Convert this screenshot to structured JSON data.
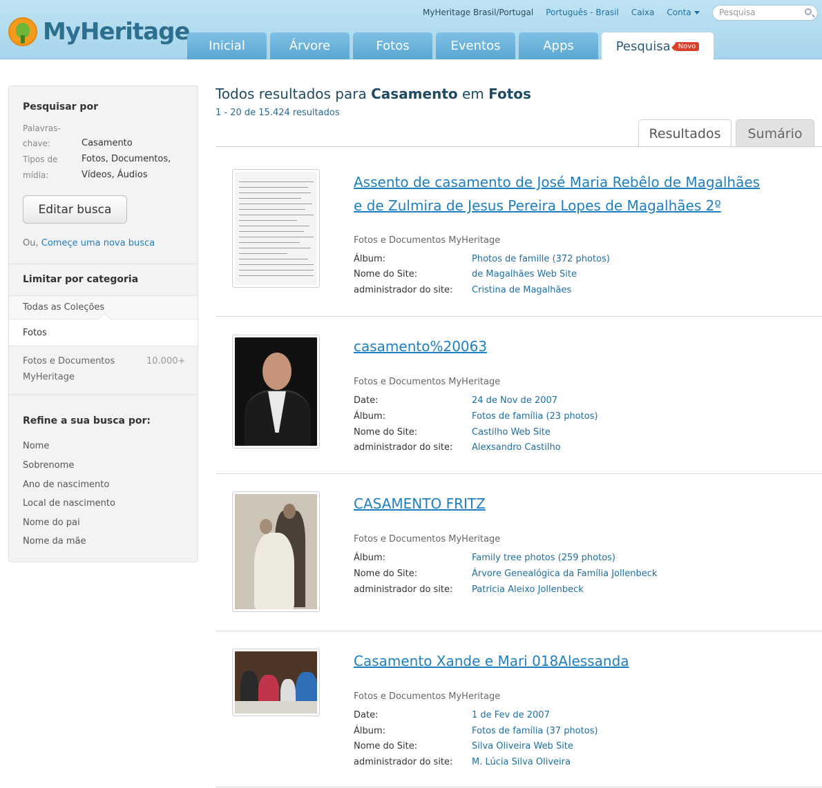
{
  "header": {
    "logo_text": "MyHeritage",
    "top_links": [
      "MyHeritage Brasil/Portugal",
      "Português - Brasil",
      "Caixa",
      "Conta"
    ],
    "search_placeholder": "Pesquisa",
    "tabs": [
      "Inicial",
      "Árvore",
      "Fotos",
      "Eventos",
      "Apps",
      "Pesquisa"
    ],
    "active_tab": "Pesquisa",
    "new_badge": "Novo"
  },
  "sidebar": {
    "search_by_heading": "Pesquisar por",
    "keywords_label_line1": "Palavras-",
    "keywords_label_line2": "chave:",
    "keywords_value": "Casamento",
    "media_label_line1": "Tipos de",
    "media_label_line2": "mídia:",
    "media_value_line1": "Fotos, Documentos,",
    "media_value_line2": "Vídeos, Áudios",
    "edit_button": "Editar busca",
    "or_text": "Ou,",
    "new_search_link": "Começe uma nova busca",
    "limit_heading": "Limitar por categoria",
    "all_collections": "Todas as Coleções",
    "photos_category": "Fotos",
    "subcategory_line1": "Fotos e Documentos",
    "subcategory_line2": "MyHeritage",
    "subcategory_count": "10.000+",
    "refine_heading": "Refine a sua busca por:",
    "refine_items": [
      "Nome",
      "Sobrenome",
      "Ano de nascimento",
      "Local de nascimento",
      "Nome do pai",
      "Nome da mãe"
    ]
  },
  "main": {
    "title_prefix": "Todos resultados para ",
    "title_query": "Casamento",
    "title_middle": " em ",
    "title_category": "Fotos",
    "result_count": "1 - 20 de 15.424 resultados",
    "tab_results": "Resultados",
    "tab_summary": "Sumário",
    "results": [
      {
        "title_line1": "Assento de casamento de José Maria Rebêlo de Magalhães",
        "title_line2": "e de Zulmira de Jesus Pereira Lopes de Magalhães 2º",
        "source": "Fotos e Documentos MyHeritage",
        "fields": [
          {
            "label": "Álbum:",
            "value": "Photos de famille (372 photos)"
          },
          {
            "label": "Nome do Site:",
            "value": "de Magalhães Web Site"
          },
          {
            "label": "administrador do site:",
            "value": "Cristina de Magalhães"
          }
        ]
      },
      {
        "title_line1": "casamento%20063",
        "source": "Fotos e Documentos MyHeritage",
        "fields": [
          {
            "label": "Date:",
            "value": "24 de Nov de 2007"
          },
          {
            "label": "Álbum:",
            "value": "Fotos de família (23 photos)"
          },
          {
            "label": "Nome do Site:",
            "value": "Castilho Web Site"
          },
          {
            "label": "administrador do site:",
            "value": "Alexsandro Castilho"
          }
        ]
      },
      {
        "title_line1": "CASAMENTO FRITZ",
        "source": "Fotos e Documentos MyHeritage",
        "fields": [
          {
            "label": "Álbum:",
            "value": "Family tree photos (259 photos)"
          },
          {
            "label": "Nome do Site:",
            "value": "Árvore Genealógica da Família Jollenbeck"
          },
          {
            "label": "administrador do site:",
            "value": "Patricia Aleixo Jollenbeck"
          }
        ]
      },
      {
        "title_line1": "Casamento Xande e Mari 018Alessanda",
        "source": "Fotos e Documentos MyHeritage",
        "fields": [
          {
            "label": "Date:",
            "value": "1 de Fev de 2007"
          },
          {
            "label": "Álbum:",
            "value": "Fotos de família (37 photos)"
          },
          {
            "label": "Nome do Site:",
            "value": "Silva Oliveira Web Site"
          },
          {
            "label": "administrador do site:",
            "value": "M. Lúcia Silva Oliveira"
          }
        ]
      }
    ]
  },
  "colors": {
    "link": "#1e7fc0",
    "header_bg": "#a6d5ec",
    "tab_bg": "#5aa6d2",
    "badge": "#d9402c",
    "logo_orange": "#f39b1c",
    "logo_green": "#6cb536"
  }
}
